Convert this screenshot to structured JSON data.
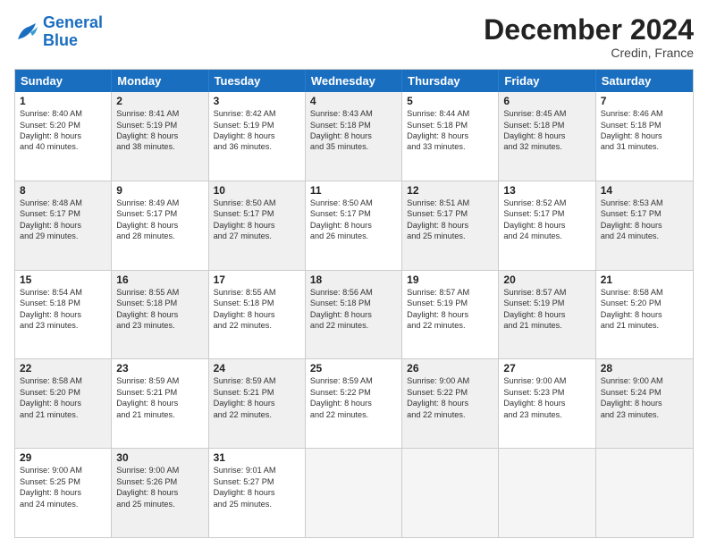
{
  "logo": {
    "text_general": "General",
    "text_blue": "Blue"
  },
  "title": "December 2024",
  "location": "Credin, France",
  "days": [
    "Sunday",
    "Monday",
    "Tuesday",
    "Wednesday",
    "Thursday",
    "Friday",
    "Saturday"
  ],
  "weeks": [
    [
      {
        "day": "1",
        "rise": "Sunrise: 8:40 AM",
        "set": "Sunset: 5:20 PM",
        "daylight": "Daylight: 8 hours",
        "minutes": "and 40 minutes.",
        "shade": false
      },
      {
        "day": "2",
        "rise": "Sunrise: 8:41 AM",
        "set": "Sunset: 5:19 PM",
        "daylight": "Daylight: 8 hours",
        "minutes": "and 38 minutes.",
        "shade": true
      },
      {
        "day": "3",
        "rise": "Sunrise: 8:42 AM",
        "set": "Sunset: 5:19 PM",
        "daylight": "Daylight: 8 hours",
        "minutes": "and 36 minutes.",
        "shade": false
      },
      {
        "day": "4",
        "rise": "Sunrise: 8:43 AM",
        "set": "Sunset: 5:18 PM",
        "daylight": "Daylight: 8 hours",
        "minutes": "and 35 minutes.",
        "shade": true
      },
      {
        "day": "5",
        "rise": "Sunrise: 8:44 AM",
        "set": "Sunset: 5:18 PM",
        "daylight": "Daylight: 8 hours",
        "minutes": "and 33 minutes.",
        "shade": false
      },
      {
        "day": "6",
        "rise": "Sunrise: 8:45 AM",
        "set": "Sunset: 5:18 PM",
        "daylight": "Daylight: 8 hours",
        "minutes": "and 32 minutes.",
        "shade": true
      },
      {
        "day": "7",
        "rise": "Sunrise: 8:46 AM",
        "set": "Sunset: 5:18 PM",
        "daylight": "Daylight: 8 hours",
        "minutes": "and 31 minutes.",
        "shade": false
      }
    ],
    [
      {
        "day": "8",
        "rise": "Sunrise: 8:48 AM",
        "set": "Sunset: 5:17 PM",
        "daylight": "Daylight: 8 hours",
        "minutes": "and 29 minutes.",
        "shade": true
      },
      {
        "day": "9",
        "rise": "Sunrise: 8:49 AM",
        "set": "Sunset: 5:17 PM",
        "daylight": "Daylight: 8 hours",
        "minutes": "and 28 minutes.",
        "shade": false
      },
      {
        "day": "10",
        "rise": "Sunrise: 8:50 AM",
        "set": "Sunset: 5:17 PM",
        "daylight": "Daylight: 8 hours",
        "minutes": "and 27 minutes.",
        "shade": true
      },
      {
        "day": "11",
        "rise": "Sunrise: 8:50 AM",
        "set": "Sunset: 5:17 PM",
        "daylight": "Daylight: 8 hours",
        "minutes": "and 26 minutes.",
        "shade": false
      },
      {
        "day": "12",
        "rise": "Sunrise: 8:51 AM",
        "set": "Sunset: 5:17 PM",
        "daylight": "Daylight: 8 hours",
        "minutes": "and 25 minutes.",
        "shade": true
      },
      {
        "day": "13",
        "rise": "Sunrise: 8:52 AM",
        "set": "Sunset: 5:17 PM",
        "daylight": "Daylight: 8 hours",
        "minutes": "and 24 minutes.",
        "shade": false
      },
      {
        "day": "14",
        "rise": "Sunrise: 8:53 AM",
        "set": "Sunset: 5:17 PM",
        "daylight": "Daylight: 8 hours",
        "minutes": "and 24 minutes.",
        "shade": true
      }
    ],
    [
      {
        "day": "15",
        "rise": "Sunrise: 8:54 AM",
        "set": "Sunset: 5:18 PM",
        "daylight": "Daylight: 8 hours",
        "minutes": "and 23 minutes.",
        "shade": false
      },
      {
        "day": "16",
        "rise": "Sunrise: 8:55 AM",
        "set": "Sunset: 5:18 PM",
        "daylight": "Daylight: 8 hours",
        "minutes": "and 23 minutes.",
        "shade": true
      },
      {
        "day": "17",
        "rise": "Sunrise: 8:55 AM",
        "set": "Sunset: 5:18 PM",
        "daylight": "Daylight: 8 hours",
        "minutes": "and 22 minutes.",
        "shade": false
      },
      {
        "day": "18",
        "rise": "Sunrise: 8:56 AM",
        "set": "Sunset: 5:18 PM",
        "daylight": "Daylight: 8 hours",
        "minutes": "and 22 minutes.",
        "shade": true
      },
      {
        "day": "19",
        "rise": "Sunrise: 8:57 AM",
        "set": "Sunset: 5:19 PM",
        "daylight": "Daylight: 8 hours",
        "minutes": "and 22 minutes.",
        "shade": false
      },
      {
        "day": "20",
        "rise": "Sunrise: 8:57 AM",
        "set": "Sunset: 5:19 PM",
        "daylight": "Daylight: 8 hours",
        "minutes": "and 21 minutes.",
        "shade": true
      },
      {
        "day": "21",
        "rise": "Sunrise: 8:58 AM",
        "set": "Sunset: 5:20 PM",
        "daylight": "Daylight: 8 hours",
        "minutes": "and 21 minutes.",
        "shade": false
      }
    ],
    [
      {
        "day": "22",
        "rise": "Sunrise: 8:58 AM",
        "set": "Sunset: 5:20 PM",
        "daylight": "Daylight: 8 hours",
        "minutes": "and 21 minutes.",
        "shade": true
      },
      {
        "day": "23",
        "rise": "Sunrise: 8:59 AM",
        "set": "Sunset: 5:21 PM",
        "daylight": "Daylight: 8 hours",
        "minutes": "and 21 minutes.",
        "shade": false
      },
      {
        "day": "24",
        "rise": "Sunrise: 8:59 AM",
        "set": "Sunset: 5:21 PM",
        "daylight": "Daylight: 8 hours",
        "minutes": "and 22 minutes.",
        "shade": true
      },
      {
        "day": "25",
        "rise": "Sunrise: 8:59 AM",
        "set": "Sunset: 5:22 PM",
        "daylight": "Daylight: 8 hours",
        "minutes": "and 22 minutes.",
        "shade": false
      },
      {
        "day": "26",
        "rise": "Sunrise: 9:00 AM",
        "set": "Sunset: 5:22 PM",
        "daylight": "Daylight: 8 hours",
        "minutes": "and 22 minutes.",
        "shade": true
      },
      {
        "day": "27",
        "rise": "Sunrise: 9:00 AM",
        "set": "Sunset: 5:23 PM",
        "daylight": "Daylight: 8 hours",
        "minutes": "and 23 minutes.",
        "shade": false
      },
      {
        "day": "28",
        "rise": "Sunrise: 9:00 AM",
        "set": "Sunset: 5:24 PM",
        "daylight": "Daylight: 8 hours",
        "minutes": "and 23 minutes.",
        "shade": true
      }
    ],
    [
      {
        "day": "29",
        "rise": "Sunrise: 9:00 AM",
        "set": "Sunset: 5:25 PM",
        "daylight": "Daylight: 8 hours",
        "minutes": "and 24 minutes.",
        "shade": false
      },
      {
        "day": "30",
        "rise": "Sunrise: 9:00 AM",
        "set": "Sunset: 5:26 PM",
        "daylight": "Daylight: 8 hours",
        "minutes": "and 25 minutes.",
        "shade": true
      },
      {
        "day": "31",
        "rise": "Sunrise: 9:01 AM",
        "set": "Sunset: 5:27 PM",
        "daylight": "Daylight: 8 hours",
        "minutes": "and 25 minutes.",
        "shade": false
      },
      null,
      null,
      null,
      null
    ]
  ]
}
